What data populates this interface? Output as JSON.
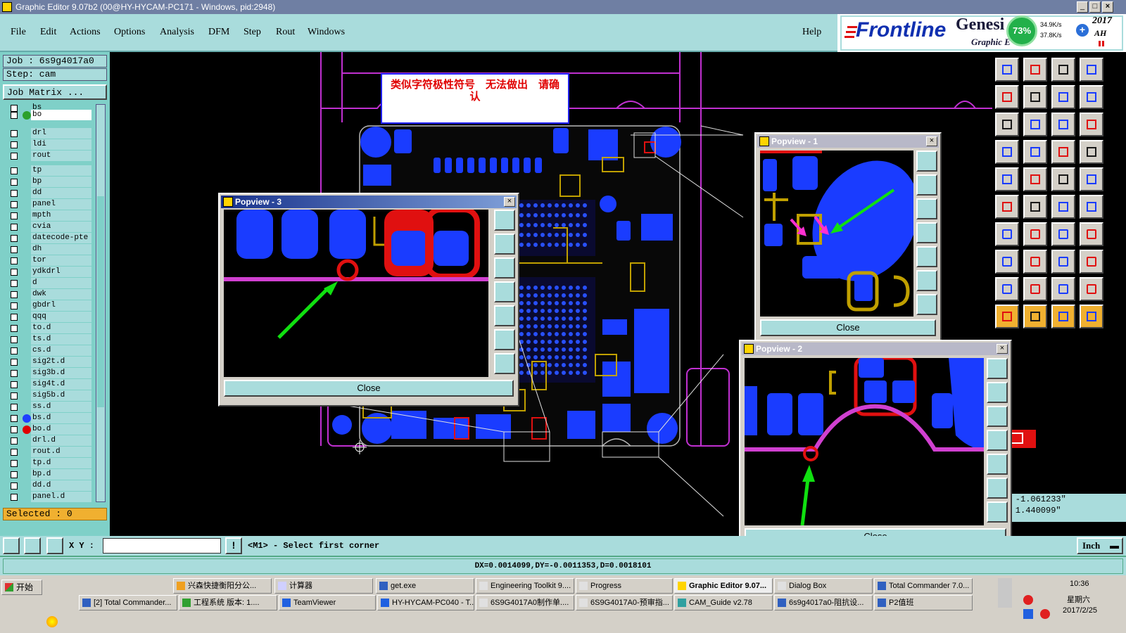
{
  "window": {
    "title": "Graphic Editor 9.07b2 (00@HY-HYCAM-PC171 - Windows, pid:2948)"
  },
  "menu": {
    "items": [
      "File",
      "Edit",
      "Actions",
      "Options",
      "Analysis",
      "DFM",
      "Step",
      "Rout",
      "Windows"
    ],
    "help": "Help"
  },
  "brand": {
    "frontline": "Frontline",
    "genesis": "Genesi",
    "graphic": "Graphic E",
    "cpu": "73%",
    "net_up": "34.9K/s",
    "net_down": "37.8K/s",
    "year": "2017",
    "ah": "AH"
  },
  "job": {
    "job_label": "Job : 6s9g4017a0",
    "step_label": "Step: cam",
    "matrix_button": "Job Matrix ..."
  },
  "layers": [
    {
      "name": "bs",
      "dot": ""
    },
    {
      "name": "bo",
      "dot": "#2ca02c",
      "active": true
    },
    {
      "name": "drl",
      "dot": ""
    },
    {
      "name": "ldi",
      "dot": ""
    },
    {
      "name": "rout",
      "dot": ""
    },
    {
      "name": "tp",
      "dot": ""
    },
    {
      "name": "bp",
      "dot": ""
    },
    {
      "name": "dd",
      "dot": ""
    },
    {
      "name": "panel",
      "dot": ""
    },
    {
      "name": "mpth",
      "dot": ""
    },
    {
      "name": "cvia",
      "dot": ""
    },
    {
      "name": "datecode-pte",
      "dot": ""
    },
    {
      "name": "dh",
      "dot": ""
    },
    {
      "name": "tor",
      "dot": ""
    },
    {
      "name": "ydkdrl",
      "dot": ""
    },
    {
      "name": "d",
      "dot": ""
    },
    {
      "name": "dwk",
      "dot": ""
    },
    {
      "name": "gbdrl",
      "dot": ""
    },
    {
      "name": "qqq",
      "dot": ""
    },
    {
      "name": "to.d",
      "dot": ""
    },
    {
      "name": "ts.d",
      "dot": ""
    },
    {
      "name": "cs.d",
      "dot": ""
    },
    {
      "name": "sig2t.d",
      "dot": ""
    },
    {
      "name": "sig3b.d",
      "dot": ""
    },
    {
      "name": "sig4t.d",
      "dot": ""
    },
    {
      "name": "sig5b.d",
      "dot": ""
    },
    {
      "name": "ss.d",
      "dot": ""
    },
    {
      "name": "bs.d",
      "dot": "#1f3fff"
    },
    {
      "name": "bo.d",
      "dot": "#e00000"
    },
    {
      "name": "drl.d",
      "dot": ""
    },
    {
      "name": "rout.d",
      "dot": ""
    },
    {
      "name": "tp.d",
      "dot": ""
    },
    {
      "name": "bp.d",
      "dot": ""
    },
    {
      "name": "dd.d",
      "dot": ""
    },
    {
      "name": "panel.d",
      "dot": ""
    }
  ],
  "selected": "Selected : 0",
  "note": "类似字符极性符号　无法做出　请确认",
  "popviews": {
    "p1": {
      "title": "Popview - 1",
      "close": "Close"
    },
    "p2": {
      "title": "Popview - 2",
      "close": "Close"
    },
    "p3": {
      "title": "Popview - 3",
      "close": "Close"
    }
  },
  "coords": {
    "x": "X = -1.061233\"",
    "y": "Y = 1.440099\""
  },
  "command": {
    "xy_label": "X Y :",
    "prompt": "<M1> - Select first corner",
    "unit": "Inch"
  },
  "status": "DX=0.0014099,DY=-0.0011353,D=0.0018101",
  "taskbar": {
    "start": "开始",
    "row1": [
      "兴森快捷衡阳分公...",
      "计算器",
      "get.exe",
      "Engineering Toolkit 9....",
      "Progress",
      "Graphic Editor 9.07...",
      "Dialog Box",
      "Total Commander 7.0..."
    ],
    "row2": [
      "[2] Total Commander...",
      "工程系统 版本: 1....",
      "TeamViewer",
      "HY-HYCAM-PC040 - T...",
      "6S9G4017A0制作单....",
      "6S9G4017A0-预审指...",
      "CAM_Guide v2.78",
      "6s9g4017a0-阻抗设...",
      "P2值班"
    ],
    "time": "10:36",
    "weekday": "星期六",
    "date": "2017/2/25"
  }
}
